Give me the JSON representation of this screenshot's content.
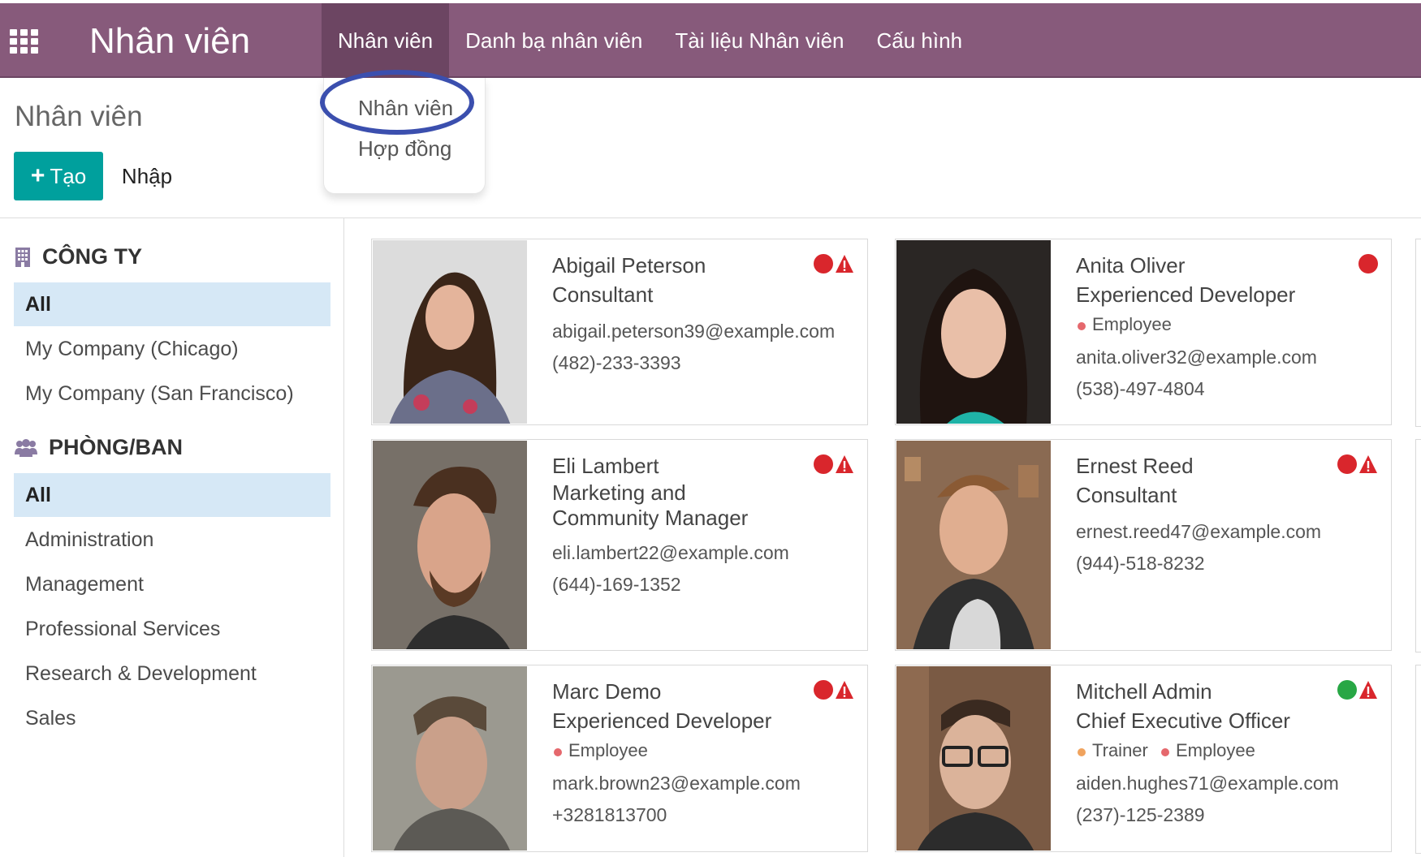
{
  "app": {
    "title": "Nhân viên",
    "menu": [
      "Nhân viên",
      "Danh bạ nhân viên",
      "Tài liệu Nhân viên",
      "Cấu hình"
    ],
    "dropdown": [
      "Nhân viên",
      "Hợp đồng"
    ]
  },
  "control": {
    "breadcrumb": "Nhân viên",
    "create_label": "Tạo",
    "import_label": "Nhập"
  },
  "sidebar": {
    "company_heading": "CÔNG TY",
    "companies": [
      "All",
      "My Company (Chicago)",
      "My Company (San Francisco)"
    ],
    "department_heading": "PHÒNG/BAN",
    "departments": [
      "All",
      "Administration",
      "Management",
      "Professional Services",
      "Research & Development",
      "Sales"
    ]
  },
  "employees": [
    {
      "name": "Abigail Peterson",
      "job": "Consultant",
      "tags": [],
      "email": "abigail.peterson39@example.com",
      "phone": "(482)-233-3393",
      "status": "red",
      "warning": true
    },
    {
      "name": "Anita Oliver",
      "job": "Experienced Developer",
      "tags": [
        "Employee"
      ],
      "email": "anita.oliver32@example.com",
      "phone": "(538)-497-4804",
      "status": "red",
      "warning": false
    },
    {
      "name": "Eli Lambert",
      "job": "Marketing and Community Manager",
      "tags": [],
      "email": "eli.lambert22@example.com",
      "phone": "(644)-169-1352",
      "status": "red",
      "warning": true
    },
    {
      "name": "Ernest Reed",
      "job": "Consultant",
      "tags": [],
      "email": "ernest.reed47@example.com",
      "phone": "(944)-518-8232",
      "status": "red",
      "warning": true
    },
    {
      "name": "Marc Demo",
      "job": "Experienced Developer",
      "tags": [
        "Employee"
      ],
      "email": "mark.brown23@example.com",
      "phone": "+3281813700",
      "status": "red",
      "warning": true
    },
    {
      "name": "Mitchell Admin",
      "job": "Chief Executive Officer",
      "tags": [
        "Trainer",
        "Employee"
      ],
      "email": "aiden.hughes71@example.com",
      "phone": "(237)-125-2389",
      "status": "green",
      "warning": true
    }
  ],
  "colors": {
    "brand": "#875a7b",
    "primary_button": "#00a09d",
    "status_red": "#d9262c",
    "status_green": "#28a745",
    "tag_employee": "#e5686d",
    "tag_trainer": "#f0a35e",
    "highlight_oval": "#3b4fae"
  }
}
